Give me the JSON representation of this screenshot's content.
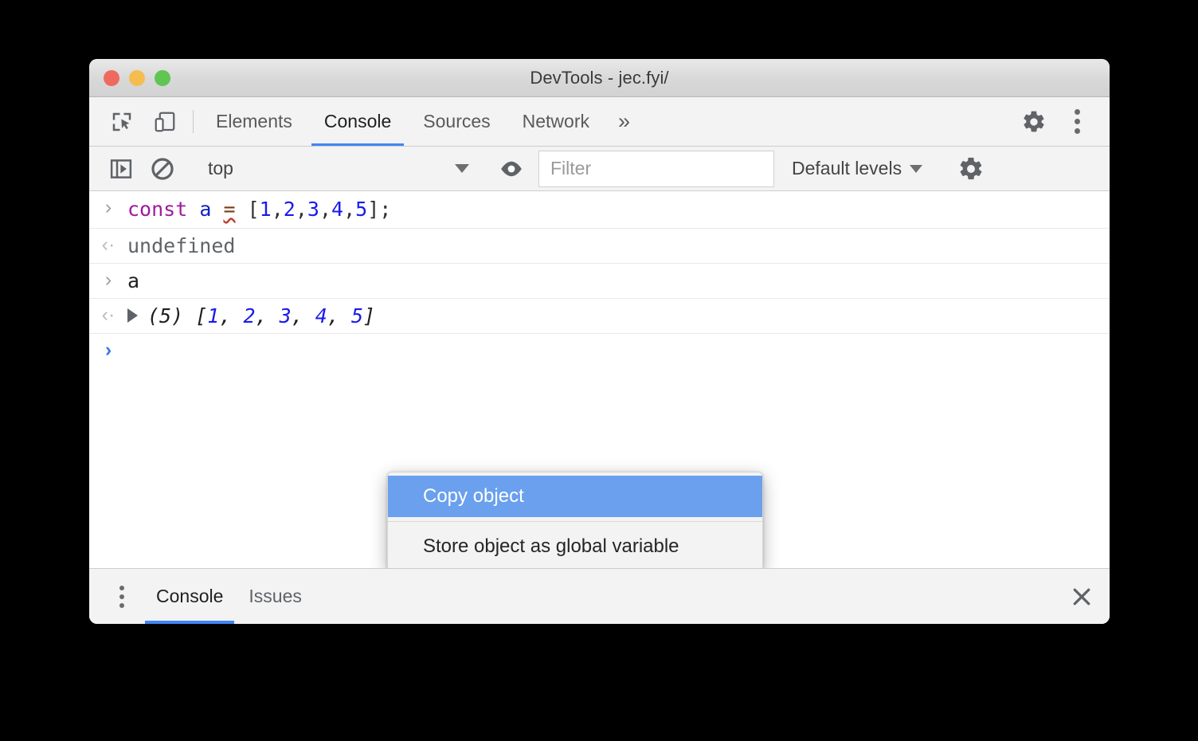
{
  "window": {
    "title": "DevTools - jec.fyi/",
    "traffic_lights": [
      {
        "name": "close",
        "color": "#ee6a5f"
      },
      {
        "name": "minimize",
        "color": "#f5bd4f"
      },
      {
        "name": "maximize",
        "color": "#61c554"
      }
    ]
  },
  "main_toolbar": {
    "icons": [
      {
        "name": "inspect-element-icon",
        "label": "Inspect element"
      },
      {
        "name": "device-toolbar-icon",
        "label": "Toggle device toolbar"
      }
    ],
    "tabs": [
      {
        "label": "Elements",
        "active": false
      },
      {
        "label": "Console",
        "active": true
      },
      {
        "label": "Sources",
        "active": false
      },
      {
        "label": "Network",
        "active": false
      }
    ],
    "overflow_label": "»",
    "right_icons": [
      {
        "name": "settings-gear-icon",
        "label": "Settings"
      },
      {
        "name": "more-options-icon",
        "label": "Customize and control DevTools"
      }
    ],
    "accent_color": "#4285f4"
  },
  "console_toolbar": {
    "sidebar_toggle": "console-sidebar-icon",
    "clear_console": "clear-console-icon",
    "context_selector": {
      "value": "top",
      "caret": "▼"
    },
    "eye_icon": "live-expression-eye-icon",
    "filter": {
      "placeholder": "Filter",
      "value": ""
    },
    "levels": {
      "label": "Default levels",
      "caret": "▼"
    },
    "settings_icon": "console-settings-gear-icon"
  },
  "console_rows": [
    {
      "type": "input",
      "marker": "›",
      "tokens": [
        {
          "text": "const",
          "cls": "kw-const"
        },
        {
          "text": " ",
          "cls": "punct"
        },
        {
          "text": "a",
          "cls": "kw-var"
        },
        {
          "text": " ",
          "cls": "punct"
        },
        {
          "text": "=",
          "cls": "kw-op"
        },
        {
          "text": " [",
          "cls": "punct"
        },
        {
          "text": "1",
          "cls": "num"
        },
        {
          "text": ",",
          "cls": "punct"
        },
        {
          "text": "2",
          "cls": "num"
        },
        {
          "text": ",",
          "cls": "punct"
        },
        {
          "text": "3",
          "cls": "num"
        },
        {
          "text": ",",
          "cls": "punct"
        },
        {
          "text": "4",
          "cls": "num"
        },
        {
          "text": ",",
          "cls": "punct"
        },
        {
          "text": "5",
          "cls": "num"
        },
        {
          "text": "];",
          "cls": "punct"
        }
      ],
      "plain": "const a = [1,2,3,4,5];"
    },
    {
      "type": "output",
      "marker": "‹·",
      "plain": "undefined"
    },
    {
      "type": "input",
      "marker": "›",
      "plain": "a"
    },
    {
      "type": "output-array",
      "marker": "‹·",
      "prefix": "(5)",
      "open": " [",
      "items": [
        "1",
        "2",
        "3",
        "4",
        "5"
      ],
      "close": "]",
      "plain": "(5) [1, 2, 3, 4, 5]"
    },
    {
      "type": "prompt",
      "marker": "›",
      "plain": ""
    }
  ],
  "context_menu": {
    "highlight_color": "#6aa0ee",
    "items": [
      {
        "label": "Copy object",
        "highlighted": true
      },
      {
        "label": "Store object as global variable",
        "highlighted": false
      }
    ]
  },
  "drawer": {
    "more_icon": "drawer-more-options-icon",
    "tabs": [
      {
        "label": "Console",
        "active": true
      },
      {
        "label": "Issues",
        "active": false
      }
    ],
    "close_label": "✕"
  }
}
